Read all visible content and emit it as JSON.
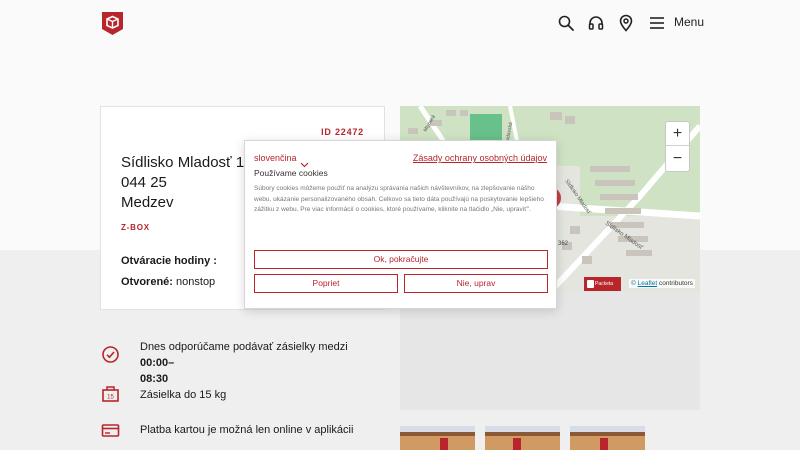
{
  "header": {
    "logo_icon": "packeta-box-logo",
    "search_icon": "search-icon",
    "support_icon": "headset-icon",
    "location_icon": "map-pin-icon",
    "menu_icon": "hamburger-icon",
    "menu_label": "Menu"
  },
  "pickup_point": {
    "id_label": "ID 22472",
    "address_line1": "Sídlisko Mladosť 10",
    "address_line2": "044 25",
    "address_line3": "Medzev",
    "type_label": "Z-BOX",
    "hours_title": "Otváracie hodiny :",
    "open_label": "Otvorené:",
    "open_value": "nonstop"
  },
  "map": {
    "zoom_in": "+",
    "zoom_out": "−",
    "badge_label": "Packeta",
    "attribution_prefix": "©",
    "attribution_link": "Leaflet",
    "attribution_suffix": "contributors",
    "labels": {
      "street_a": "Sídlisko Mladosť",
      "street_b": "Sídlisko Mladosť",
      "street_c": "Mlynská",
      "street_d": "Moldavská",
      "road_number": "362"
    }
  },
  "features": [
    {
      "icon": "clock-check-icon",
      "text_before": "Dnes odporúčame podávať zásielky medzi ",
      "text_bold_1": "00:00–",
      "text_bold_2": "08:30"
    },
    {
      "icon": "scale-weight-icon",
      "text": "Zásielka do 15 kg",
      "icon_number": "15"
    },
    {
      "icon": "credit-card-icon",
      "text": "Platba kartou je možná len online v aplikácii"
    }
  ],
  "cookie_modal": {
    "language": "slovenčina",
    "policy_link": "Zásady ochrany osobných údajov",
    "title": "Používame cookies",
    "body": "Súbory cookies môžeme použiť na analýzu správania našich návštevníkov, na zlepšovanie nášho webu, ukázanie personalizovaného obsah. Celkovo sa tieto dáta používajú na poskytovanie lepšieho zážitku z webu. Pre viac informácií o cookies, ktoré používame, kliknite na tlačidlo „Nie, upraviť\".",
    "accept_button": "Ok, pokračujte",
    "reject_button": "Popriet",
    "adjust_button": "Nie, uprav"
  },
  "colors": {
    "brand_red": "#b8252b",
    "page_bg": "#fafafa",
    "lower_bg": "#efefef"
  }
}
